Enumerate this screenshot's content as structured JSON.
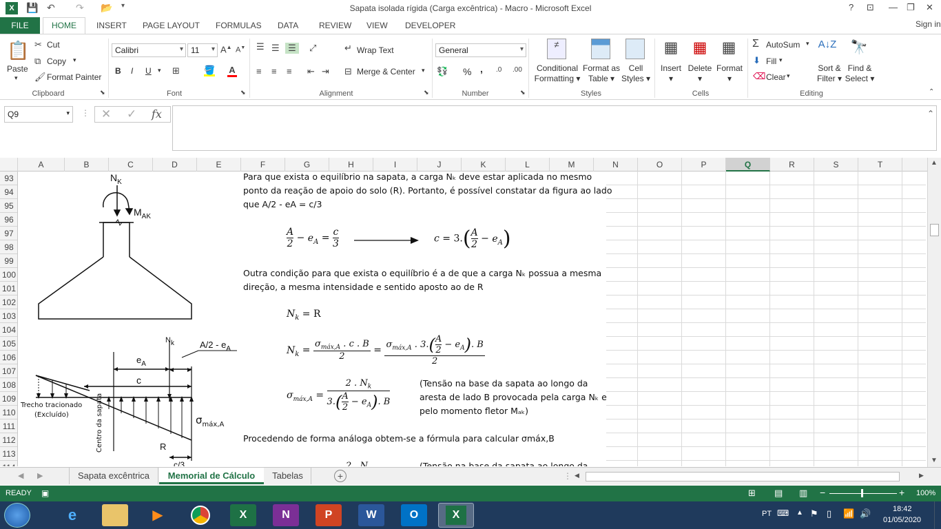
{
  "window": {
    "title": "Sapata isolada rígida (Carga excêntrica) - Macro - Microsoft Excel",
    "help": "?",
    "signin": "Sign in"
  },
  "tabs": [
    "FILE",
    "HOME",
    "INSERT",
    "PAGE LAYOUT",
    "FORMULAS",
    "DATA",
    "REVIEW",
    "VIEW",
    "DEVELOPER"
  ],
  "ribbon": {
    "clipboard": {
      "paste": "Paste",
      "cut": "Cut",
      "copy": "Copy",
      "format_painter": "Format Painter",
      "label": "Clipboard"
    },
    "font": {
      "name": "Calibri",
      "size": "11",
      "bold": "B",
      "italic": "I",
      "underline": "U",
      "label": "Font"
    },
    "alignment": {
      "wrap": "Wrap Text",
      "merge": "Merge & Center",
      "label": "Alignment"
    },
    "number": {
      "format": "General",
      "percent": "%",
      "comma": ",",
      "label": "Number"
    },
    "styles": {
      "conditional": "Conditional\nFormatting",
      "format_table": "Format as\nTable",
      "cell_styles": "Cell\nStyles",
      "label": "Styles"
    },
    "cells": {
      "insert": "Insert",
      "delete": "Delete",
      "format": "Format",
      "label": "Cells"
    },
    "editing": {
      "autosum": "AutoSum",
      "fill": "Fill",
      "clear": "Clear",
      "sort": "Sort &\nFilter",
      "find": "Find &\nSelect",
      "label": "Editing"
    }
  },
  "formula_bar": {
    "namebox": "Q9",
    "fx": "fx",
    "value": ""
  },
  "columns": [
    "A",
    "B",
    "C",
    "D",
    "E",
    "F",
    "G",
    "H",
    "I",
    "J",
    "K",
    "L",
    "M",
    "N",
    "O",
    "P",
    "Q",
    "R",
    "S",
    "T"
  ],
  "rows": [
    "93",
    "94",
    "95",
    "96",
    "97",
    "98",
    "99",
    "100",
    "101",
    "102",
    "103",
    "104",
    "105",
    "106",
    "107",
    "108",
    "109",
    "110",
    "111",
    "112",
    "113",
    "114"
  ],
  "selected_column": "Q",
  "text": {
    "p1a": "Para que exista o equilíbrio na sapata, a carga Nₖ deve estar aplicada no mesmo",
    "p1b": "ponto da reação de apoio do solo (R). Portanto, é possível constatar da figura ao lado",
    "p1c": "que A/2 - eA = c/3",
    "p2a": "Outra condição para que exista o equilíbrio é a de que a carga Nₖ possua a mesma",
    "p2b": "direção, a mesma intensidade e sentido aposto ao de R",
    "p3a": "(Tensão na base da sapata ao longo da",
    "p3b": "aresta de lado B provocada pela carga Nₖ e",
    "p3c": "pelo momento fletor Mₐₖ)",
    "p4": "Procedendo de forma análoga obtem-se a fórmula para calcular σmáx,B",
    "p5": "(Tensão na base da sapata ao longo da"
  },
  "diagram": {
    "nk": "NK",
    "mak": "MAK",
    "nk2": "Nk",
    "a2ea": "A/2 - eA",
    "ea": "eA",
    "c": "c",
    "tracionado": "Trecho tracionado",
    "excluido": "(Excluído)",
    "sigma": "σmáx,A",
    "centro": "Centro da sapata",
    "r": "R",
    "c3": "c/3"
  },
  "sheets": [
    "Sapata excêntrica",
    "Memorial de Cálculo",
    "Tabelas"
  ],
  "active_sheet": "Memorial de Cálculo",
  "status": {
    "ready": "READY",
    "zoom": "100%"
  },
  "taskbar": {
    "lang": "PT",
    "time": "18:42",
    "date": "01/05/2020"
  }
}
